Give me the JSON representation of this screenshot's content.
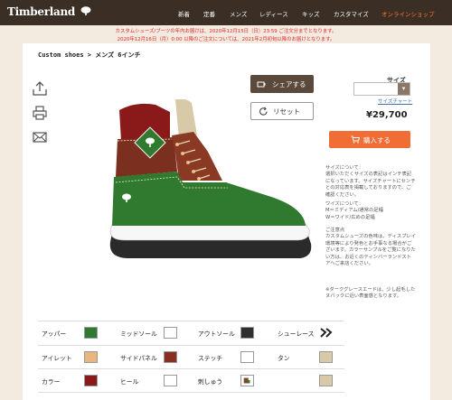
{
  "header": {
    "logo": "Timberland",
    "nav": [
      "新着",
      "定番",
      "メンズ",
      "レディース",
      "キッズ",
      "カスタマイズ"
    ],
    "online_shop": "オンラインショップ"
  },
  "notice": {
    "line1": "カスタムシューズ/ブーツの年内お届けは、2020年12月15日（日）23:59 ご注文分までとなります。",
    "line2": "2020年12月16日（月）0:00 以降のご注文については、2021年2月初旬以降のお届けとなります。"
  },
  "breadcrumb": "Custom shoes > メンズ 6インチ",
  "actions": {
    "share": "シェアする",
    "reset": "リセット"
  },
  "purchase": {
    "size_label": "サイズ",
    "size_chart": "サイズチャート",
    "size_value": "",
    "price": "¥29,700",
    "buy": "購入する"
  },
  "info": {
    "p1": "サイズについて：\n選択いただくサイズの表記はインチ表記になっています。サイズチャートにセンチとの対応表を掲載しておりますので、ご確認ください。",
    "p2": "ワイズについて：\nM＝ミディアム/通常の足幅\nW＝ワイド/広めの足幅",
    "p3": "ご注意点\nカスタムシューズの色味は、ディスプレイ環境等により発色とお手事なる場合がございます。カラーサンプルをご覧になりたい方は、お近くのティンバーランドストアへご来店ください。",
    "p4": "※ダークグレースエードは、少し起毛したヌバックに近い表面感となります。"
  },
  "options": [
    {
      "label": "アッパー",
      "color": "#2f7a2f"
    },
    {
      "label": "ミッドソール",
      "color": "#ffffff"
    },
    {
      "label": "アウトソール",
      "color": "#2f2f2f"
    },
    {
      "label": "シューレース",
      "color": "pattern"
    },
    {
      "label": "アイレット",
      "color": "#e9b67f"
    },
    {
      "label": "サイドパネル",
      "color": "#8a2f1f"
    },
    {
      "label": "ステッチ",
      "color": "#ffffff"
    },
    {
      "label": "タン",
      "color": "#d8c9a8"
    },
    {
      "label": "カラー",
      "color": "#8a1a1a"
    },
    {
      "label": "ヒール",
      "color": "#ffffff"
    },
    {
      "label": "刺しゅう",
      "color": "tree"
    },
    {
      "label": "",
      "color": "#d8c9a8"
    }
  ]
}
